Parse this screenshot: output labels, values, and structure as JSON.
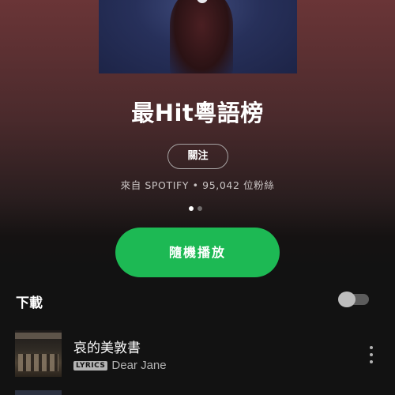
{
  "playlist": {
    "title": "最Hit粵語榜",
    "follow_label": "關注",
    "meta": "來自 SPOTIFY • 95,042 位粉絲",
    "carousel_pages": 2,
    "carousel_active": 1
  },
  "actions": {
    "shuffle_label": "隨機播放",
    "download_label": "下載",
    "download_toggle_on": false
  },
  "tracks": [
    {
      "title": "哀的美敦書",
      "badge": "LYRICS",
      "artist": "Dear Jane"
    }
  ],
  "colors": {
    "accent": "#1db954",
    "header_gradient_top": "#6a3537",
    "background": "#121212",
    "secondary_text": "#b3b3b3"
  },
  "icons": {
    "track_menu": "more-vertical-icon"
  }
}
